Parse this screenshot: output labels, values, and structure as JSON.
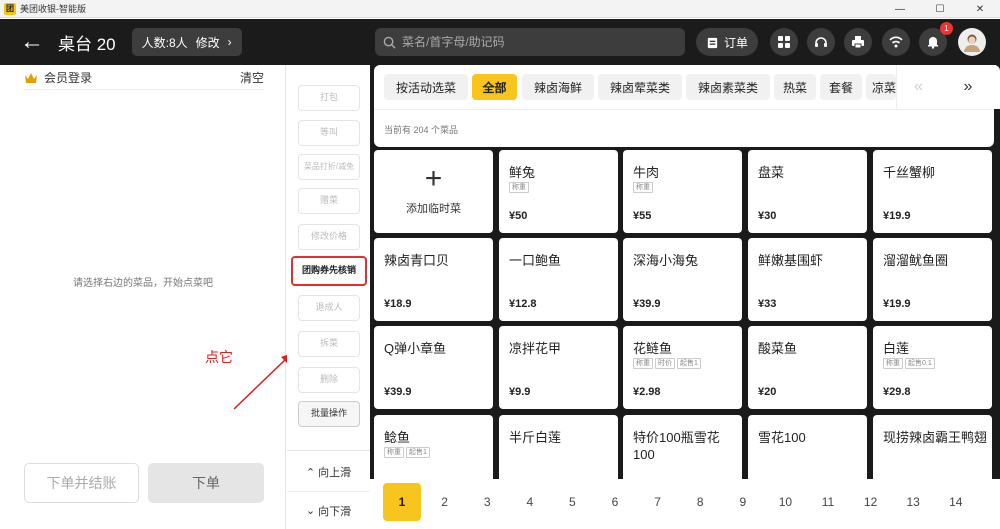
{
  "window": {
    "title": "美团收银-智能版",
    "logo": "团"
  },
  "header": {
    "table_name": "桌台 20",
    "people_label": "人数:8人",
    "edit_label": "修改",
    "search_placeholder": "菜名/首字母/助记码",
    "order_label": "订单",
    "notification_count": "1",
    "icons": [
      "grid-icon",
      "headset-icon",
      "printer-icon",
      "wifi-icon",
      "bell-icon",
      "avatar"
    ]
  },
  "left": {
    "member_login": "会员登录",
    "clear": "清空",
    "empty_hint": "请选择右边的菜品，开始点菜吧",
    "settle_button": "下单并结账",
    "order_button": "下单",
    "annotation": "点它"
  },
  "actions": {
    "items": [
      "打包",
      "等叫",
      "菜品打折/减免",
      "赠菜",
      "修改价格",
      "团购券先核销",
      "退成人",
      "拆菜",
      "删除",
      "批量操作"
    ],
    "scroll_up": "向上滑",
    "scroll_down": "向下滑"
  },
  "categories": {
    "items": [
      "按活动选菜",
      "全部",
      "辣卤海鲜",
      "辣卤荤菜类",
      "辣卤素菜类",
      "热菜",
      "套餐",
      "凉菜"
    ],
    "selected": "全部"
  },
  "dishes": {
    "count_text": "当前有 204 个菜品",
    "add_temp": "添加临时菜",
    "items": [
      {
        "name": "鲜兔",
        "price": "¥50",
        "tags": [
          "称重"
        ]
      },
      {
        "name": "牛肉",
        "price": "¥55",
        "tags": [
          "称重"
        ]
      },
      {
        "name": "盘菜",
        "price": "¥30",
        "tags": []
      },
      {
        "name": "千丝蟹柳",
        "price": "¥19.9",
        "tags": []
      },
      {
        "name": "辣卤青口贝",
        "price": "¥18.9",
        "tags": []
      },
      {
        "name": "一口鲍鱼",
        "price": "¥12.8",
        "tags": []
      },
      {
        "name": "深海小海兔",
        "price": "¥39.9",
        "tags": []
      },
      {
        "name": "鲜嫩基围虾",
        "price": "¥33",
        "tags": []
      },
      {
        "name": "溜溜鱿鱼圈",
        "price": "¥19.9",
        "tags": []
      },
      {
        "name": "Q弹小章鱼",
        "price": "¥39.9",
        "tags": []
      },
      {
        "name": "凉拌花甲",
        "price": "¥9.9",
        "tags": []
      },
      {
        "name": "花鲢鱼",
        "price": "¥2.98",
        "tags": [
          "称重",
          "时价",
          "起售1"
        ]
      },
      {
        "name": "酸菜鱼",
        "price": "¥20",
        "tags": []
      },
      {
        "name": "白莲",
        "price": "¥29.8",
        "tags": [
          "称重",
          "起售0.1"
        ]
      },
      {
        "name": "鲶鱼",
        "price": "",
        "tags": [
          "称重",
          "起售1"
        ]
      },
      {
        "name": "半斤白莲",
        "price": "",
        "tags": []
      },
      {
        "name": "特价100瓶雪花100",
        "price": "",
        "tags": []
      },
      {
        "name": "雪花100",
        "price": "",
        "tags": []
      },
      {
        "name": "现捞辣卤霸王鸭翅",
        "price": "",
        "tags": []
      }
    ]
  },
  "pagination": {
    "pages": [
      "1",
      "2",
      "3",
      "4",
      "5",
      "6",
      "7",
      "8",
      "9",
      "10",
      "11",
      "12",
      "13",
      "14"
    ],
    "current": "1"
  }
}
